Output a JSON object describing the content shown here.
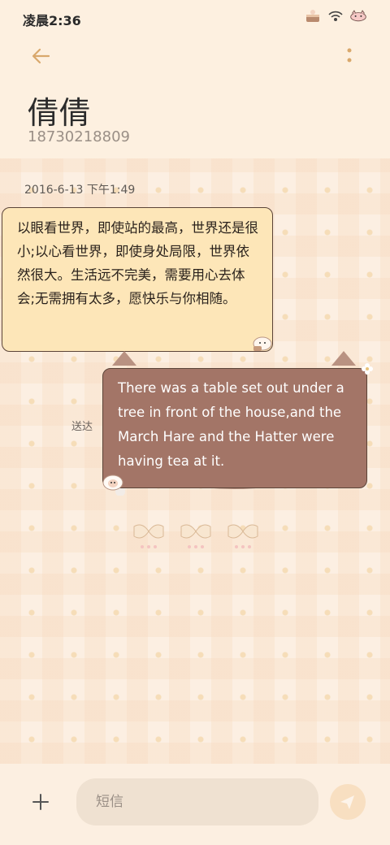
{
  "status": {
    "time": "凌晨2:36"
  },
  "contact": {
    "name": "倩倩",
    "phone": "18730218809"
  },
  "messages": [
    {
      "direction": "incoming",
      "timestamp": "2016-6-13 下午1:49",
      "text": "以眼看世界，即使站的最高，世界还是很小;以心看世界，即使身处局限，世界依然很大。生活远不完美，需要用心去体会;无需拥有太多，愿快乐与你相随。"
    },
    {
      "direction": "outgoing",
      "status": "送达",
      "text": "There was a table set out under a tree in front of the house,and the March Hare and the Hatter were having tea at it."
    }
  ],
  "compose": {
    "placeholder": "短信"
  },
  "icons": [
    "back-arrow-icon",
    "more-vertical-icon",
    "plus-icon",
    "send-icon",
    "wifi-icon",
    "battery-icon"
  ],
  "colors": {
    "incoming_bubble": "#fde6b8",
    "outgoing_bubble": "#a37567",
    "accent": "#e0b080"
  }
}
